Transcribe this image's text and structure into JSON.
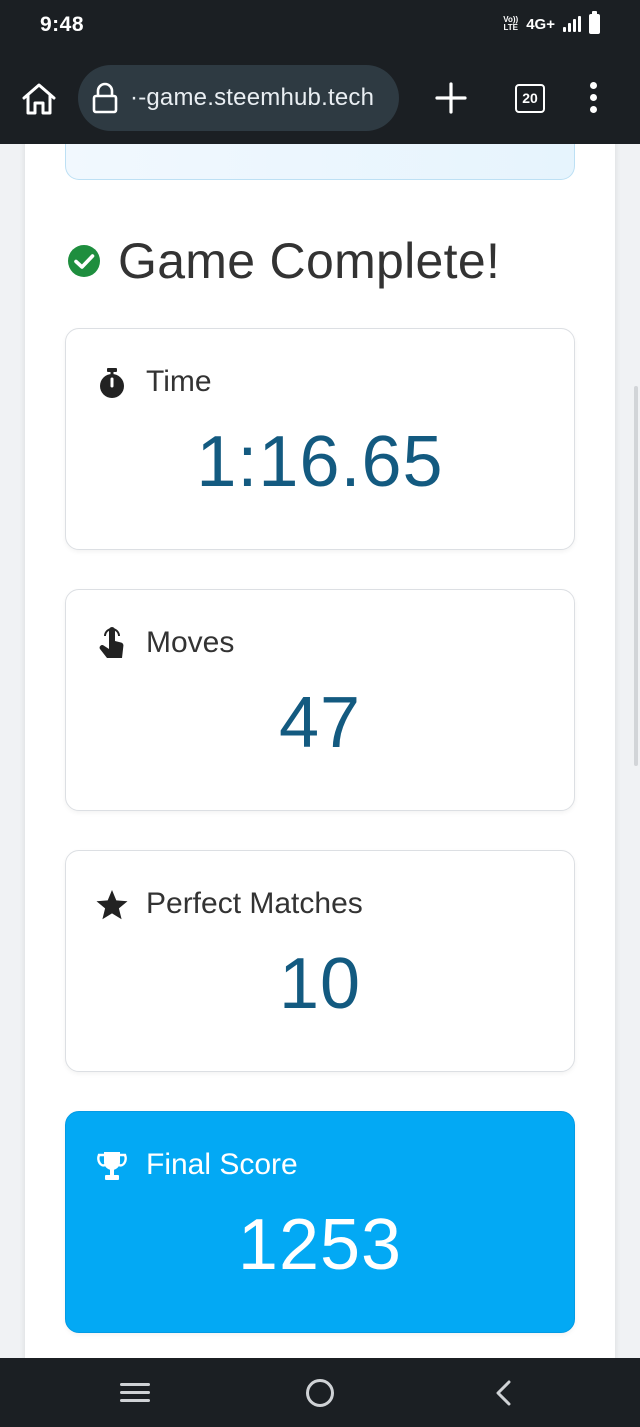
{
  "status_bar": {
    "time": "9:48",
    "volte_line1": "Vo))",
    "volte_line2": "LTE",
    "network": "4G+"
  },
  "browser": {
    "url": "·-game.steemhub.tech",
    "tab_count": "20"
  },
  "game": {
    "title": "Game Complete!",
    "stats": [
      {
        "label": "Time",
        "value": "1:16.65",
        "icon": "stopwatch-icon"
      },
      {
        "label": "Moves",
        "value": "47",
        "icon": "pointing-hand-icon"
      },
      {
        "label": "Perfect Matches",
        "value": "10",
        "icon": "star-icon"
      },
      {
        "label": "Final Score",
        "value": "1253",
        "icon": "trophy-icon"
      }
    ]
  },
  "colors": {
    "accent": "#03a9f4",
    "value_text": "#135a80",
    "success": "#1e8e3e"
  }
}
